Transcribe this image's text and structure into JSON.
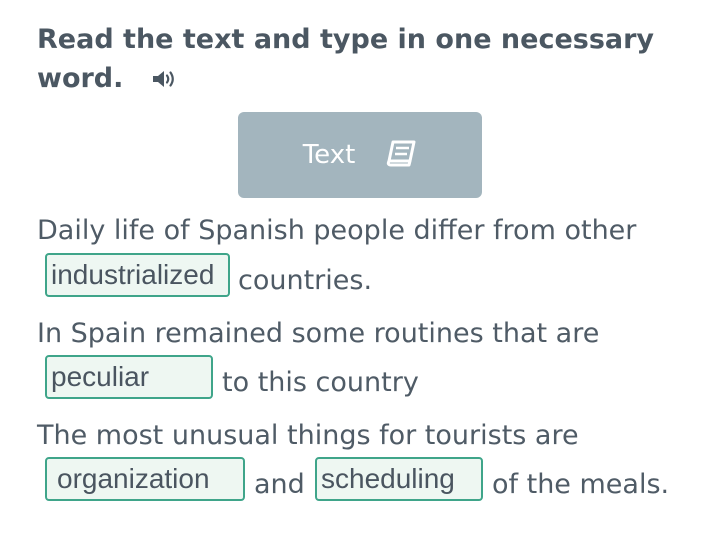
{
  "task": {
    "heading": "Read the text and type in one necessary word.",
    "audio_icon": "speaker-icon"
  },
  "text_button": {
    "label": "Text",
    "icon": "book-icon"
  },
  "sentences": [
    {
      "before": "Daily life of Spanish people differ from other",
      "answer": "industrialized",
      "after": "countries."
    },
    {
      "before": "In Spain remained some routines that are",
      "answer": "peculiar",
      "after": "to this country"
    },
    {
      "before": "The most unusual things for tourists are",
      "answer_1": "organization",
      "middle": "and",
      "answer_2": "scheduling",
      "after": "of the meals."
    }
  ],
  "colors": {
    "button_bg": "#a3b5be",
    "input_border": "#3fa58a",
    "input_bg": "#eef7f2",
    "text": "#4f5b66"
  }
}
